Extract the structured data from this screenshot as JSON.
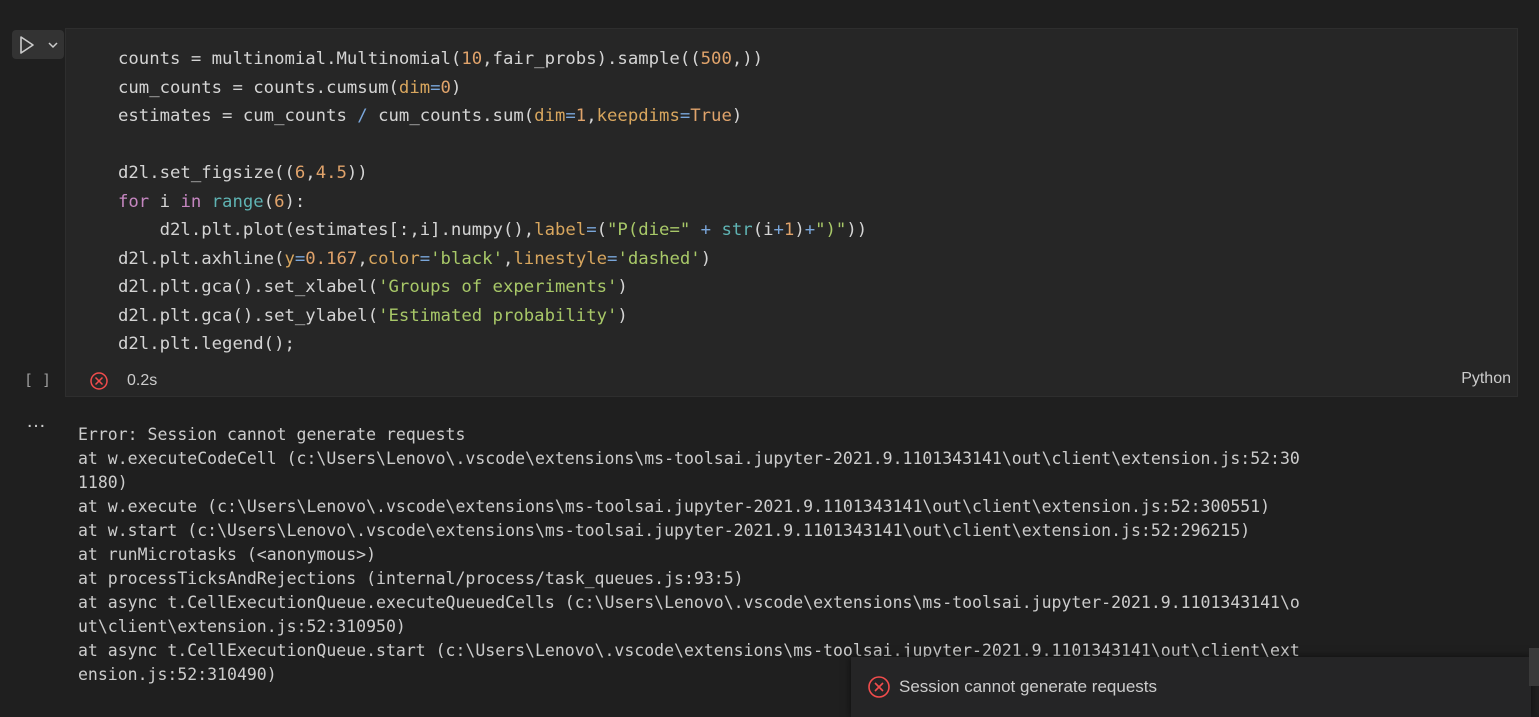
{
  "run_button": {
    "icon": "play-icon",
    "dropdown_icon": "chevron-down-icon"
  },
  "cell": {
    "code_lines": [
      [
        [
          "counts = multinomial.Multinomial(",
          "plain"
        ],
        [
          "10",
          "num"
        ],
        [
          ",fair_probs).sample((",
          "plain"
        ],
        [
          "500",
          "num"
        ],
        [
          ",))",
          "plain"
        ]
      ],
      [
        [
          "cum_counts = counts.cumsum(",
          "plain"
        ],
        [
          "dim",
          "param"
        ],
        [
          "=",
          "op"
        ],
        [
          "0",
          "num"
        ],
        [
          ")",
          "plain"
        ]
      ],
      [
        [
          "estimates = cum_counts ",
          "plain"
        ],
        [
          "/",
          "op"
        ],
        [
          " cum_counts.sum(",
          "plain"
        ],
        [
          "dim",
          "param"
        ],
        [
          "=",
          "op"
        ],
        [
          "1",
          "num"
        ],
        [
          ",",
          "plain"
        ],
        [
          "keepdims",
          "param"
        ],
        [
          "=",
          "op"
        ],
        [
          "True",
          "num"
        ],
        [
          ")",
          "plain"
        ]
      ],
      [
        [
          "",
          "plain"
        ]
      ],
      [
        [
          "d2l.set_figsize((",
          "plain"
        ],
        [
          "6",
          "num"
        ],
        [
          ",",
          "plain"
        ],
        [
          "4.5",
          "num"
        ],
        [
          "))",
          "plain"
        ]
      ],
      [
        [
          "for",
          "kw"
        ],
        [
          " i ",
          "plain"
        ],
        [
          "in",
          "kw"
        ],
        [
          " ",
          "plain"
        ],
        [
          "range",
          "builtin"
        ],
        [
          "(",
          "plain"
        ],
        [
          "6",
          "num"
        ],
        [
          "):",
          "plain"
        ]
      ],
      [
        [
          "    d2l.plt.plot(estimates[:,i].numpy(),",
          "plain"
        ],
        [
          "label",
          "param"
        ],
        [
          "=",
          "op"
        ],
        [
          "(",
          "plain"
        ],
        [
          "\"P(die=\"",
          "str"
        ],
        [
          " ",
          "plain"
        ],
        [
          "+",
          "op"
        ],
        [
          " ",
          "plain"
        ],
        [
          "str",
          "builtin"
        ],
        [
          "(i",
          "plain"
        ],
        [
          "+",
          "op"
        ],
        [
          "1",
          "num"
        ],
        [
          ")",
          "plain"
        ],
        [
          "+",
          "op"
        ],
        [
          "\")\"",
          "str"
        ],
        [
          "))",
          "plain"
        ]
      ],
      [
        [
          "d2l.plt.axhline(",
          "plain"
        ],
        [
          "y",
          "param"
        ],
        [
          "=",
          "op"
        ],
        [
          "0.167",
          "num"
        ],
        [
          ",",
          "plain"
        ],
        [
          "color",
          "param"
        ],
        [
          "=",
          "op"
        ],
        [
          "'black'",
          "str"
        ],
        [
          ",",
          "plain"
        ],
        [
          "linestyle",
          "param"
        ],
        [
          "=",
          "op"
        ],
        [
          "'dashed'",
          "str"
        ],
        [
          ")",
          "plain"
        ]
      ],
      [
        [
          "d2l.plt.gca().set_xlabel(",
          "plain"
        ],
        [
          "'Groups of experiments'",
          "str"
        ],
        [
          ")",
          "plain"
        ]
      ],
      [
        [
          "d2l.plt.gca().set_ylabel(",
          "plain"
        ],
        [
          "'Estimated probability'",
          "str"
        ],
        [
          ")",
          "plain"
        ]
      ],
      [
        [
          "d2l.plt.legend();",
          "plain"
        ]
      ]
    ],
    "execution_count": "[ ]",
    "status_icon": "error-circle-icon",
    "duration": "0.2s",
    "language": "Python"
  },
  "output": {
    "menu_icon": "…",
    "lines": [
      "Error: Session cannot generate requests",
      "at w.executeCodeCell (c:\\Users\\Lenovo\\.vscode\\extensions\\ms-toolsai.jupyter-2021.9.1101343141\\out\\client\\extension.js:52:30",
      "1180)",
      "at w.execute (c:\\Users\\Lenovo\\.vscode\\extensions\\ms-toolsai.jupyter-2021.9.1101343141\\out\\client\\extension.js:52:300551)",
      "at w.start (c:\\Users\\Lenovo\\.vscode\\extensions\\ms-toolsai.jupyter-2021.9.1101343141\\out\\client\\extension.js:52:296215)",
      "at runMicrotasks (<anonymous>)",
      "at processTicksAndRejections (internal/process/task_queues.js:93:5)",
      "at async t.CellExecutionQueue.executeQueuedCells (c:\\Users\\Lenovo\\.vscode\\extensions\\ms-toolsai.jupyter-2021.9.1101343141\\o",
      "ut\\client\\extension.js:52:310950)",
      "at async t.CellExecutionQueue.start (c:\\Users\\Lenovo\\.vscode\\extensions\\ms-toolsai.jupyter-2021.9.1101343141\\out\\client\\ext",
      "ension.js:52:310490)"
    ]
  },
  "toast": {
    "icon": "error-circle-icon",
    "message": "Session cannot generate requests"
  },
  "colors": {
    "error": "#f14c4c",
    "background": "#1f1f1f",
    "cell_background": "#262626"
  }
}
